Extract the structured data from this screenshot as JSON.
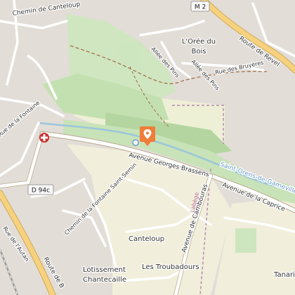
{
  "map": {
    "labels": {
      "chemin_de_canteloup": "Chemin de Canteloup",
      "loree_du_bois_1": "L'Orée du",
      "loree_du_bois_2": "Bois",
      "route_de_revel": "Route de Revel",
      "allee_des_pins_1": "Allée des Pins",
      "allee_des_pins_2": "Allée des Pins",
      "rue_des_bruyeres": "Rue des Bruyères",
      "rue_fontaine": "Rue de la Fontaine",
      "avenue_georges_brassens": "Avenue Georges Brassens",
      "saint_orens": "Saint-Orens-de-Gameville",
      "avenue_de_la_caprice": "Avenue de la Caprice",
      "chemin_fontaine_saint_sernin": "Chemin de la Fontaine Saint-Sernin",
      "avenue_de_cambouras": "Avenue de Cambouras",
      "labege": "Labège",
      "canteloup": "Canteloup",
      "lotissement_1": "Lotissement",
      "lotissement_2": "Chantecaille",
      "les_troubadours": "Les Troubadours",
      "rue_de_lautan": "Rue de l'Autan",
      "route_de_b": "Route de B",
      "tanaria": "Tanaria",
      "sanne": "Rue de"
    },
    "shields": {
      "m2": "M 2",
      "d94c": "D 94c"
    },
    "marker_icon": "location-pin-icon",
    "hospital_icon": "medical-cross-icon",
    "colors": {
      "residential": "#e0dad4",
      "park": "#cde6bf",
      "meadow": "#f2efdb",
      "wood": "#b7d6a4",
      "major_road": "#f7d27e",
      "water": "#aad3df",
      "marker": "#f07d3a",
      "boundary": "#b58bb5"
    }
  }
}
